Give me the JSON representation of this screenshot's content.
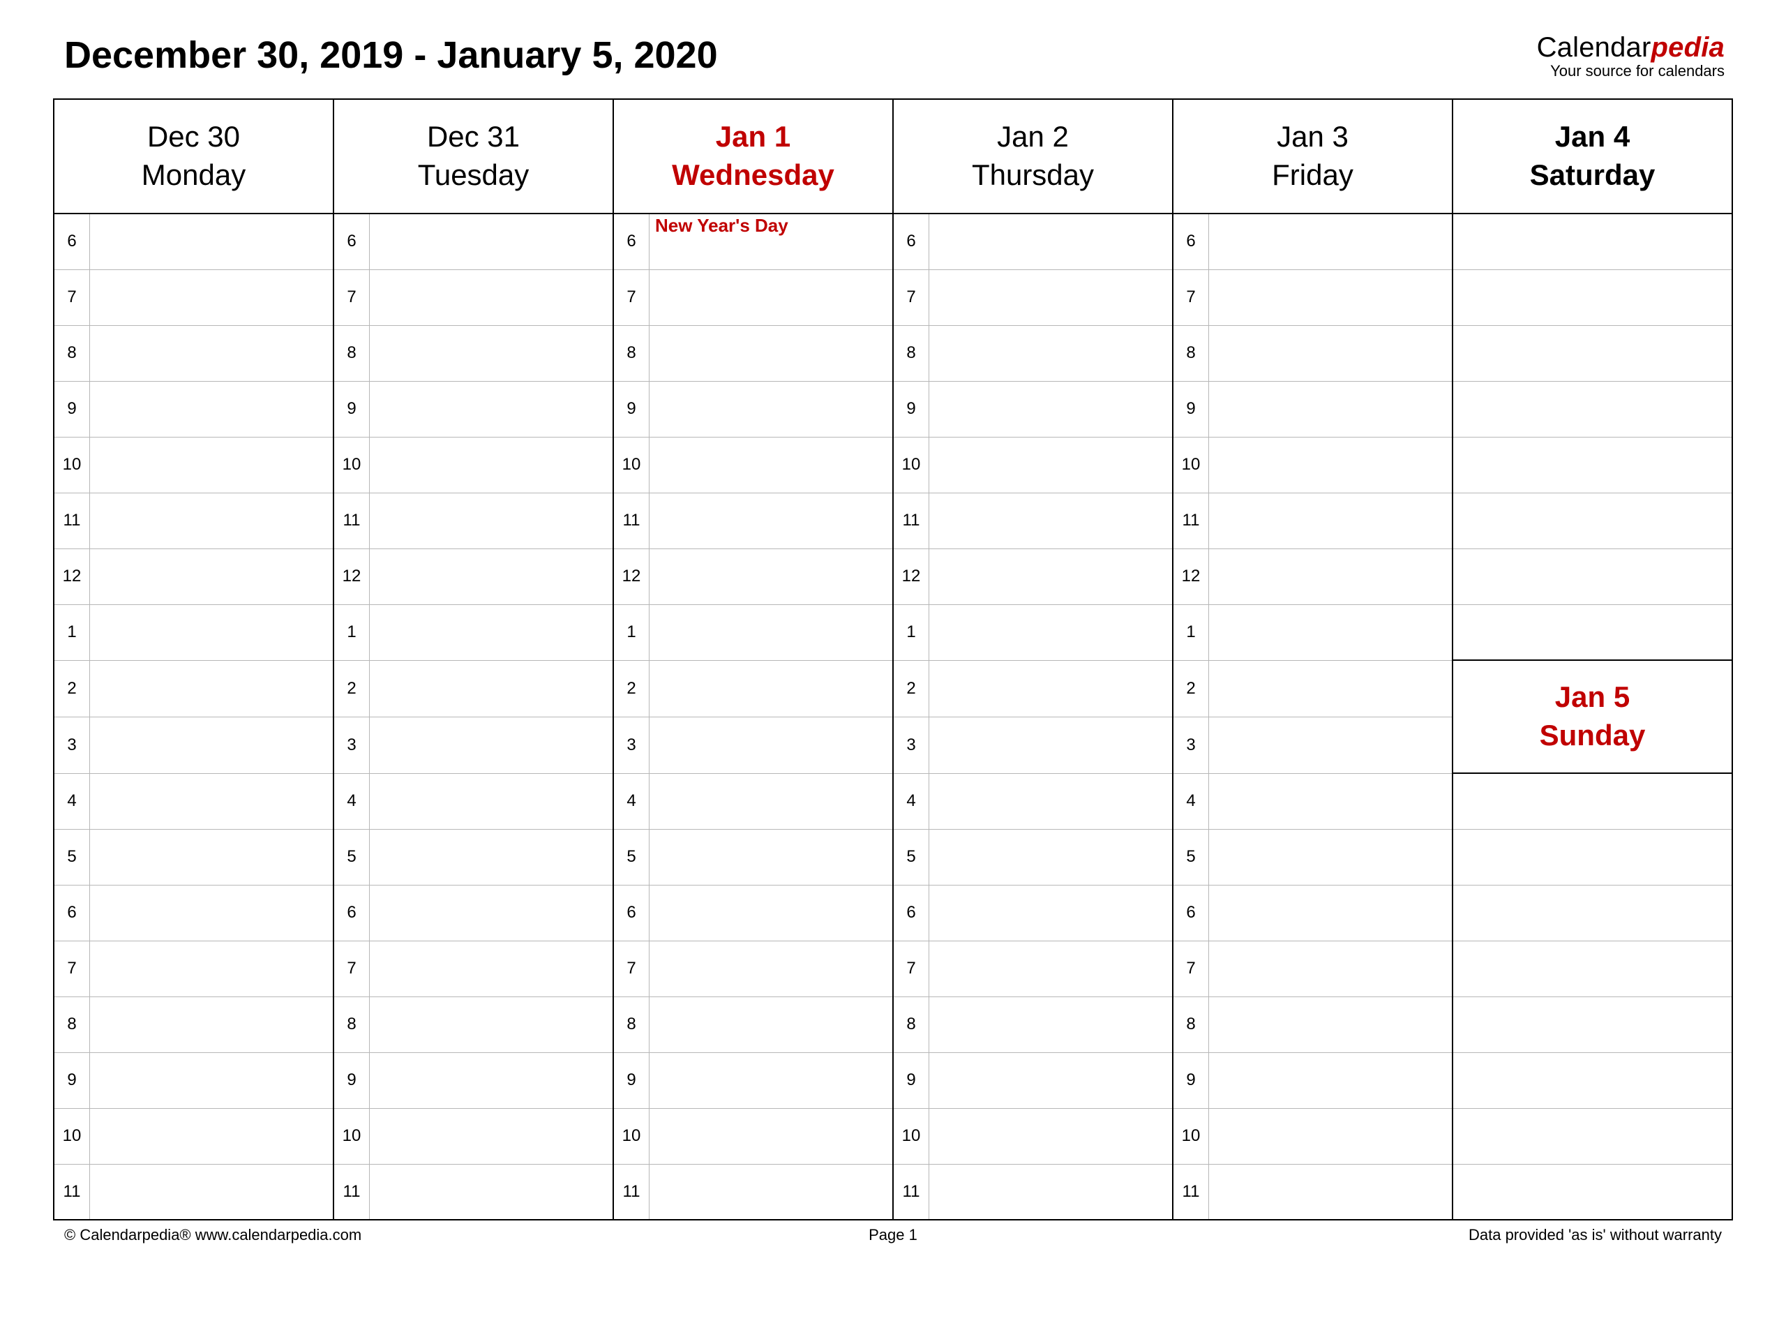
{
  "header": {
    "title": "December 30, 2019 - January 5, 2020",
    "brand_prefix": "Calendar",
    "brand_accent": "pedia",
    "brand_tagline": "Your source for calendars"
  },
  "days": [
    {
      "date": "Dec 30",
      "weekday": "Monday",
      "highlight": false,
      "event": ""
    },
    {
      "date": "Dec 31",
      "weekday": "Tuesday",
      "highlight": false,
      "event": ""
    },
    {
      "date": "Jan 1",
      "weekday": "Wednesday",
      "highlight": true,
      "event": "New Year's Day"
    },
    {
      "date": "Jan 2",
      "weekday": "Thursday",
      "highlight": false,
      "event": ""
    },
    {
      "date": "Jan 3",
      "weekday": "Friday",
      "highlight": false,
      "event": ""
    }
  ],
  "saturday": {
    "date": "Jan 4",
    "weekday": "Saturday"
  },
  "sunday": {
    "date": "Jan 5",
    "weekday": "Sunday"
  },
  "hours": [
    "6",
    "7",
    "8",
    "9",
    "10",
    "11",
    "12",
    "1",
    "2",
    "3",
    "4",
    "5",
    "6",
    "7",
    "8",
    "9",
    "10",
    "11"
  ],
  "footer": {
    "left": "© Calendarpedia®   www.calendarpedia.com",
    "center": "Page 1",
    "right": "Data provided 'as is' without warranty"
  }
}
